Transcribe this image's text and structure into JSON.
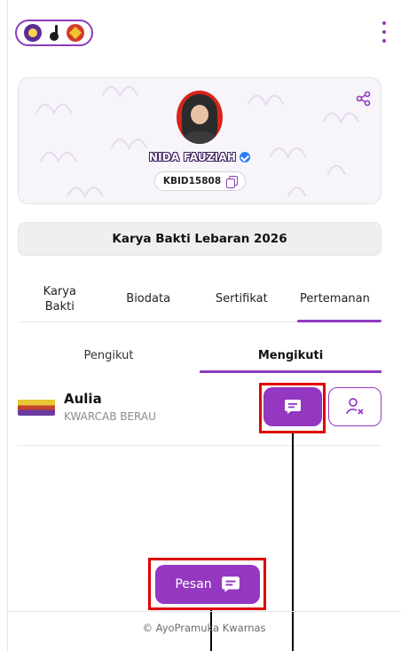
{
  "header": {
    "logos": [
      "scout-logo",
      "tunas-logo",
      "kwarnas-logo"
    ],
    "menu_icon": "kebab-menu-icon"
  },
  "profile": {
    "name": "NIDA FAUZIAH",
    "member_id": "KBID15808",
    "verified": true,
    "share_icon": "share-icon"
  },
  "event_title": "Karya Bakti Lebaran 2026",
  "tabs": [
    {
      "label": "Karya\nBakti",
      "active": false
    },
    {
      "label": "Biodata",
      "active": false
    },
    {
      "label": "Sertifikat",
      "active": false
    },
    {
      "label": "Pertemanan",
      "active": true
    }
  ],
  "subtabs": [
    {
      "label": "Pengikut",
      "active": false
    },
    {
      "label": "Mengikuti",
      "active": true
    }
  ],
  "following": [
    {
      "name": "Aulia",
      "group": "KWARCAB BERAU"
    }
  ],
  "pesan_label": "Pesan",
  "footer": "© AyoPramuka Kwarnas",
  "colors": {
    "accent": "#9437c1",
    "highlight": "#e10000"
  }
}
